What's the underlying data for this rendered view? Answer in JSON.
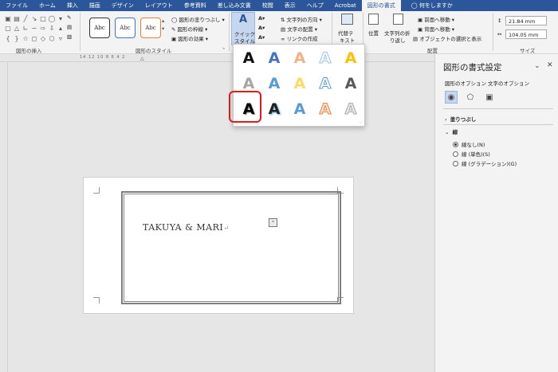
{
  "tabs": [
    "ファイル",
    "ホーム",
    "挿入",
    "描画",
    "デザイン",
    "レイアウト",
    "参考資料",
    "差し込み文書",
    "校閲",
    "表示",
    "ヘルプ",
    "Acrobat",
    "図形の書式",
    "何をしますか"
  ],
  "ribbon": {
    "insert_shapes_label": "図形の挿入",
    "shape_styles_label": "図形のスタイル",
    "abc": [
      "Abc",
      "Abc",
      "Abc"
    ],
    "fill": "図形の塗りつぶし",
    "outline": "図形の枠線",
    "effects": "図形の効果",
    "quick_style_1": "クイック",
    "quick_style_2": "スタイル",
    "text_direction": "文字列の方向",
    "text_align": "文字の配置",
    "create_link": "リンクの作成",
    "alt_text_1": "代替テ",
    "alt_text_2": "キスト",
    "position": "位置",
    "wrap_text_1": "文字列の折",
    "wrap_text_2": "り返し",
    "bring_forward": "前面へ移動",
    "send_backward": "背面へ移動",
    "selection_pane": "オブジェクトの選択と表示",
    "arrange_label": "配置",
    "size_label": "サイズ",
    "height": "21.84 mm",
    "width": "104.05 mm"
  },
  "ruler_text": "14 12 10 8 6 4 2",
  "document": {
    "text": "TAKUYA & MARI"
  },
  "gallery": {
    "letters": [
      "A",
      "A",
      "A",
      "A",
      "A",
      "A",
      "A",
      "A",
      "A",
      "A",
      "A",
      "A",
      "A",
      "A",
      "A"
    ]
  },
  "pane": {
    "title": "図形の書式設定",
    "tab_shape": "図形のオプション",
    "tab_text": "文字のオプション",
    "fill_section": "塗りつぶし",
    "line_section": "線",
    "opt_none": "線なし(N)",
    "opt_solid": "線 (単色)(S)",
    "opt_gradient": "線 (グラデーション)(G)"
  },
  "colors": {
    "accent": "#2b579a",
    "highlight": "#e01a1a"
  }
}
